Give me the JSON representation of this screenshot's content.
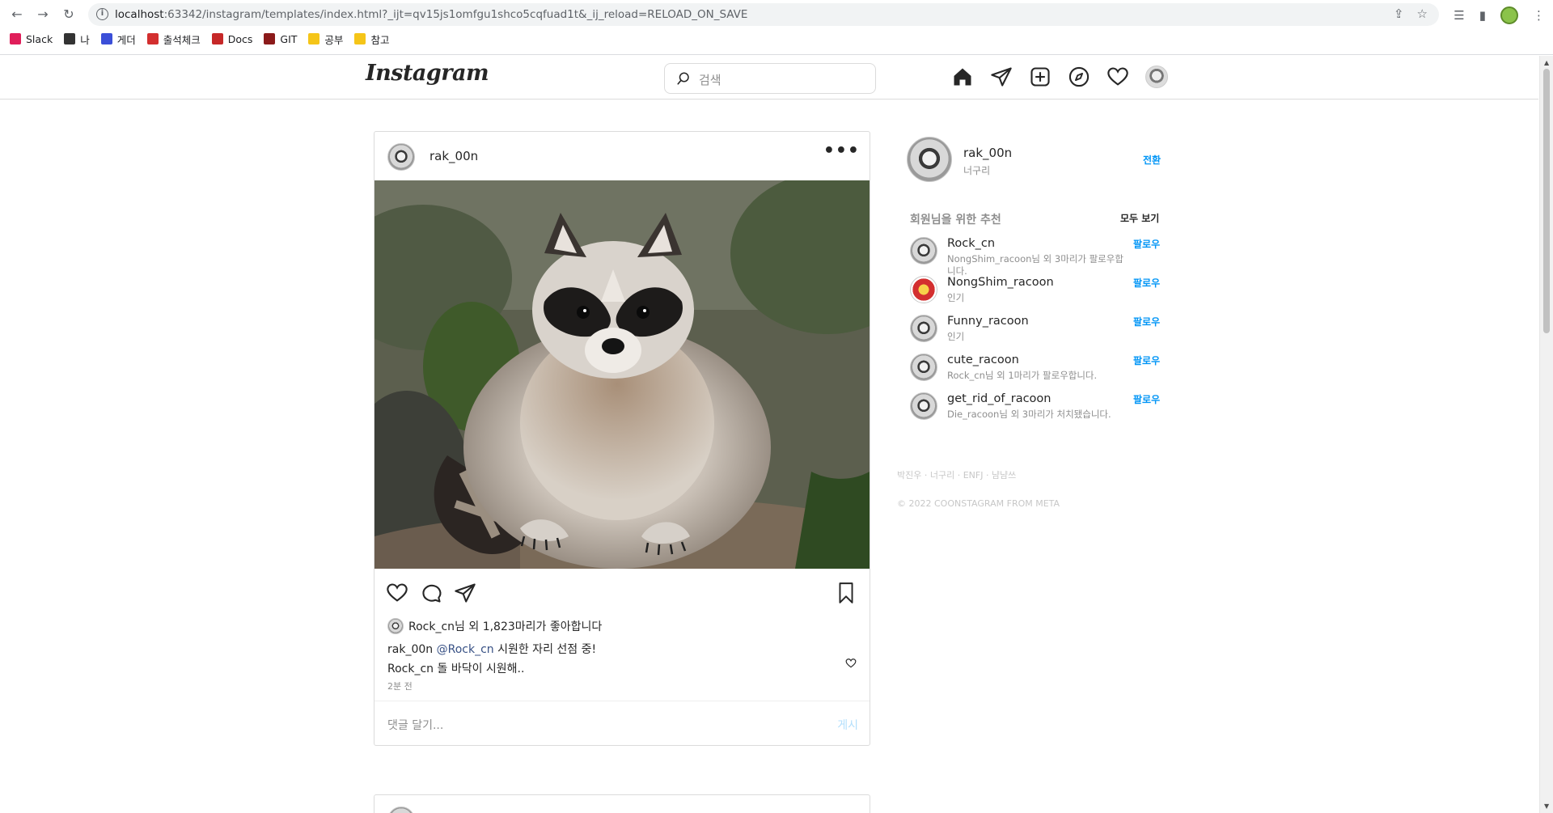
{
  "browser": {
    "url_host": "localhost",
    "url_rest": ":63342/instagram/templates/index.html?_ijt=qv15js1omfgu1shco5cqfuad1t&_ij_reload=RELOAD_ON_SAVE",
    "bookmarks": [
      {
        "label": "Slack",
        "color": "#e01e5a"
      },
      {
        "label": "나",
        "color": "#333333"
      },
      {
        "label": "게더",
        "color": "#3b4fd8"
      },
      {
        "label": "출석체크",
        "color": "#d32f2f"
      },
      {
        "label": "Docs",
        "color": "#c62828"
      },
      {
        "label": "GIT",
        "color": "#8b1a1a"
      },
      {
        "label": "공부",
        "color": "#f5c518"
      },
      {
        "label": "참고",
        "color": "#f5c518"
      }
    ]
  },
  "header": {
    "logo": "Instagram",
    "search_placeholder": "검색"
  },
  "post": {
    "username": "rak_00n",
    "likes_text": "Rock_cn님 외 1,823마리가 좋아합니다",
    "caption_user": "rak_00n",
    "caption_mention": "@Rock_cn",
    "caption_text": "시원한 자리 선점 중!",
    "comment_user": "Rock_cn",
    "comment_text": "돌 바닥이 시원해..",
    "time": "2분 전",
    "comment_placeholder": "댓글 달기...",
    "post_button": "게시"
  },
  "sidebar": {
    "username": "rak_00n",
    "realname": "너구리",
    "switch_label": "전환",
    "rec_title": "회원님을 위한 추천",
    "rec_all": "모두 보기",
    "recommendations": [
      {
        "name": "Rock_cn",
        "sub": "NongShim_racoon님 외 3마리가 팔로우합니다.",
        "follow": "팔로우"
      },
      {
        "name": "NongShim_racoon",
        "sub": "인기",
        "follow": "팔로우"
      },
      {
        "name": "Funny_racoon",
        "sub": "인기",
        "follow": "팔로우"
      },
      {
        "name": "cute_racoon",
        "sub": "Rock_cn님 외 1마리가 팔로우합니다.",
        "follow": "팔로우"
      },
      {
        "name": "get_rid_of_racoon",
        "sub": "Die_racoon님 외 3마리가 처치됐습니다.",
        "follow": "팔로우"
      }
    ],
    "footer_links": "박진우 · 너구리 · ENFJ · 냠냠쓰",
    "copyright": "© 2022 COONSTAGRAM FROM META"
  }
}
